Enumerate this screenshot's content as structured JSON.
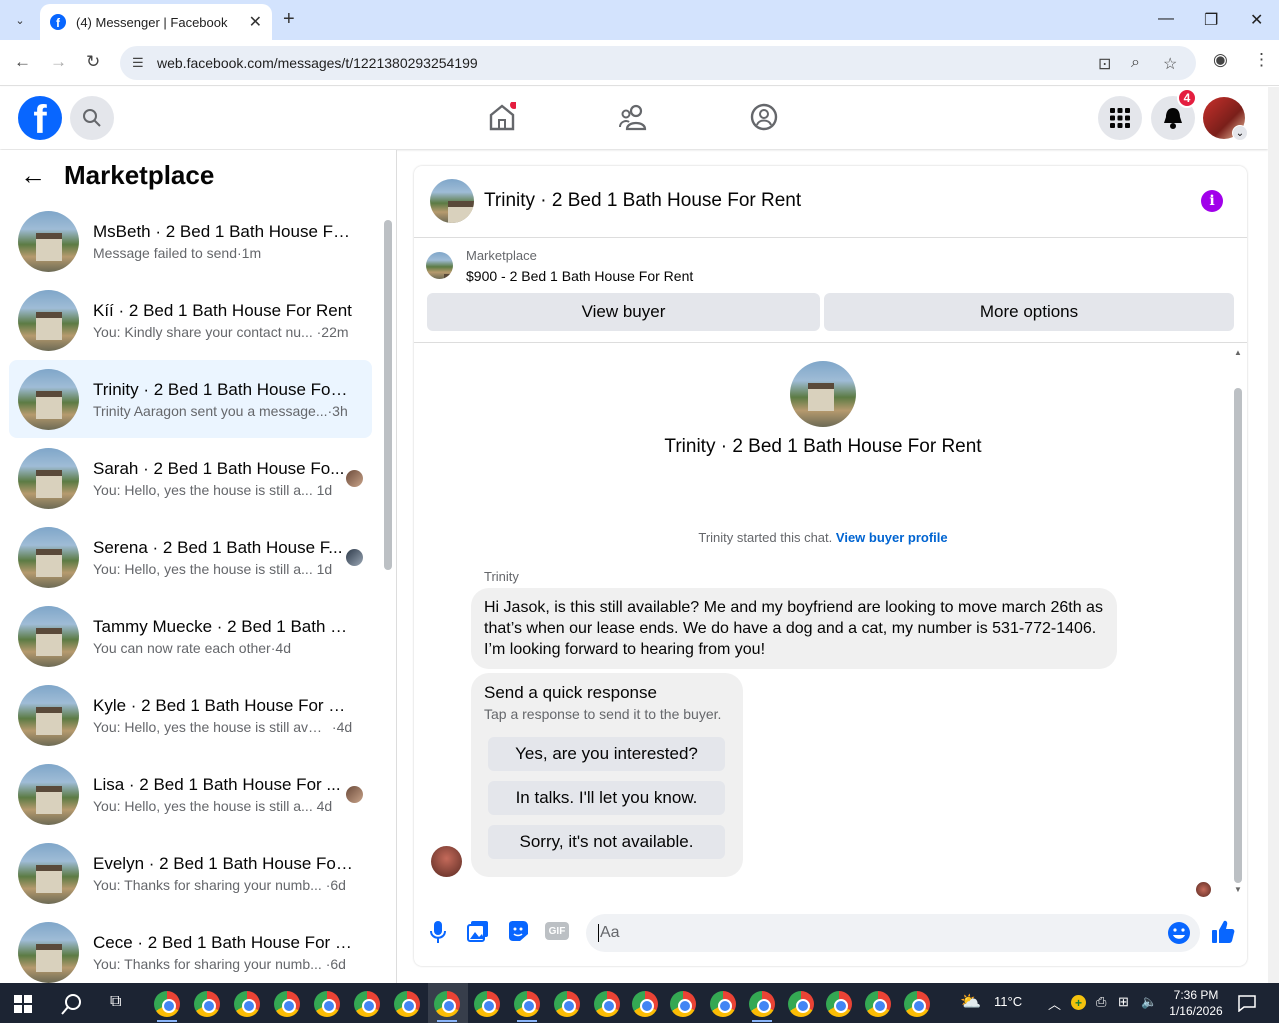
{
  "browser": {
    "tab_title": "(4) Messenger | Facebook",
    "url": "web.facebook.com/messages/t/1221380293254199"
  },
  "fb": {
    "notifications_count": "4"
  },
  "sidebar": {
    "title": "Marketplace",
    "conversations": [
      {
        "name": "MsBeth · 2 Bed 1 Bath House For...",
        "preview": "Message failed to send",
        "time": "1m"
      },
      {
        "name": "Kíí · 2 Bed 1 Bath House For Rent",
        "preview": "You: Kindly share your contact nu...",
        "time": "22m"
      },
      {
        "name": "Trinity · 2 Bed 1 Bath House For ...",
        "preview": "Trinity Aaragon sent you a message...",
        "time": "3h"
      },
      {
        "name": "Sarah · 2 Bed 1 Bath House Fo...",
        "preview": "You: Hello, yes the house is still a...",
        "time": "1d"
      },
      {
        "name": "Serena · 2 Bed 1 Bath House F...",
        "preview": "You: Hello, yes the house is still a...",
        "time": "1d"
      },
      {
        "name": "Tammy Muecke · 2 Bed 1 Bath H...",
        "preview": "You can now rate each other",
        "time": "4d"
      },
      {
        "name": "Kyle · 2 Bed 1 Bath House For Rent",
        "preview": "You: Hello, yes the house is still avai...",
        "time": "4d"
      },
      {
        "name": "Lisa · 2 Bed 1 Bath House For ...",
        "preview": "You: Hello, yes the house is still a...",
        "time": "4d"
      },
      {
        "name": "Evelyn · 2 Bed 1 Bath House For ...",
        "preview": "You: Thanks for sharing your numb...",
        "time": "6d"
      },
      {
        "name": "Cece · 2 Bed 1 Bath House For R...",
        "preview": "You: Thanks for sharing your numb...",
        "time": "6d"
      }
    ]
  },
  "chat": {
    "title": "Trinity · 2 Bed 1 Bath House For Rent",
    "marketplace_label": "Marketplace",
    "listing": "$900 - 2 Bed 1 Bath House For Rent",
    "view_buyer": "View buyer",
    "more_options": "More options",
    "center_title": "Trinity · 2 Bed 1 Bath House For Rent",
    "started_text": "Trinity started this chat.",
    "view_profile": "View buyer profile",
    "sender": "Trinity",
    "message": "Hi Jasok, is this still available? Me and my boyfriend are looking to move march 26th as that’s when our lease ends. We do have a dog and a cat, my number is 531-772-1406. I’m looking forward to hearing from you!",
    "quick_title": "Send a quick response",
    "quick_sub": "Tap a response to send it to the buyer.",
    "quick_1": "Yes, are you interested?",
    "quick_2": "In talks. I'll let you know.",
    "quick_3": "Sorry, it's not available.",
    "input_placeholder": "Aa"
  },
  "taskbar": {
    "temp": "11°C",
    "time": "7:36 PM",
    "date": "1/16/2026"
  },
  "colors": {
    "fb_blue": "#0866ff",
    "active_row": "#ebf5ff",
    "info_purple": "#a100ea"
  }
}
